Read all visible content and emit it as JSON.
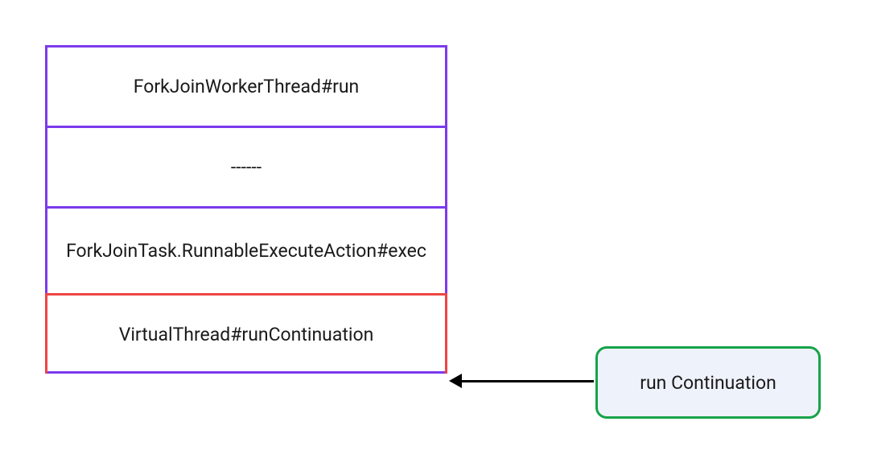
{
  "stack": {
    "frames": [
      {
        "label": "ForkJoinWorkerThread#run",
        "color": "purple"
      },
      {
        "label": "------",
        "color": "purple"
      },
      {
        "label": "ForkJoinTask.RunnableExecuteAction#exec",
        "color": "purple"
      },
      {
        "label": "VirtualThread#runContinuation",
        "color": "red"
      }
    ]
  },
  "callout": {
    "label": "run Continuation"
  },
  "colors": {
    "purple": "#7c3aed",
    "red": "#ef4444",
    "green": "#16a34a",
    "calloutBg": "#eef2fa"
  }
}
